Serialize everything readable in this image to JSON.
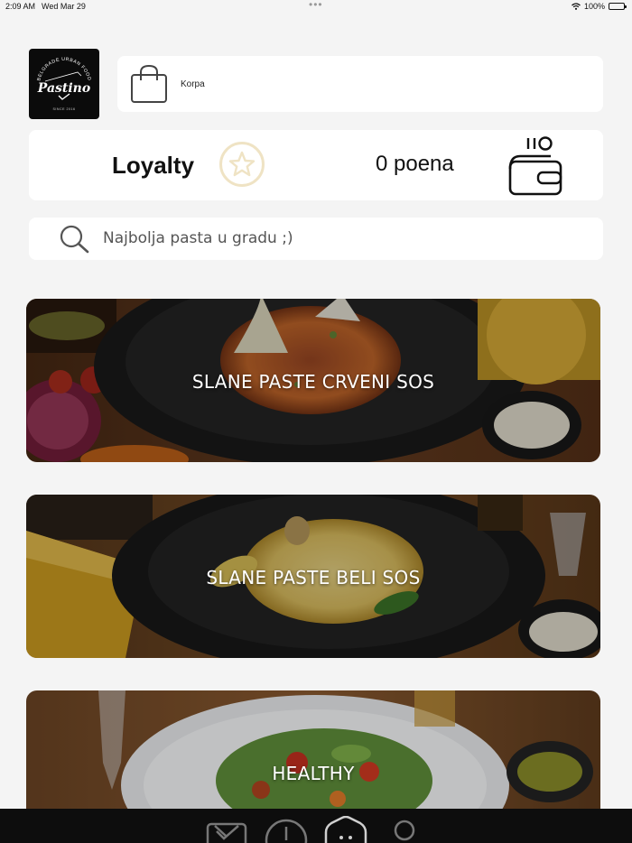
{
  "status_bar": {
    "time": "2:09 AM",
    "date": "Wed Mar 29",
    "dots": "•••",
    "battery": "100%"
  },
  "logo": {
    "brand": "Pastino",
    "tagline": "BELGRADE URBAN FOOD",
    "since": "SINCE 2016"
  },
  "cart": {
    "label": "Korpa",
    "icon": "shopping-bag-icon"
  },
  "loyalty": {
    "title": "Loyalty",
    "points": "0 poena",
    "icons": [
      "star-icon",
      "wallet-coins-icon"
    ],
    "accent": "#efe3c4"
  },
  "search": {
    "placeholder": "Najbolja pasta u gradu ;)",
    "value": ""
  },
  "categories": [
    {
      "title": "SLANE PASTE CRVENI SOS"
    },
    {
      "title": "SLANE PASTE BELI SOS"
    },
    {
      "title": "HEALTHY"
    }
  ],
  "tab_bar": {
    "items": [
      "menu-check-icon",
      "clock-icon",
      "home-icon",
      "profile-icon"
    ],
    "active": "home-icon",
    "background": "#0d0d0d"
  }
}
